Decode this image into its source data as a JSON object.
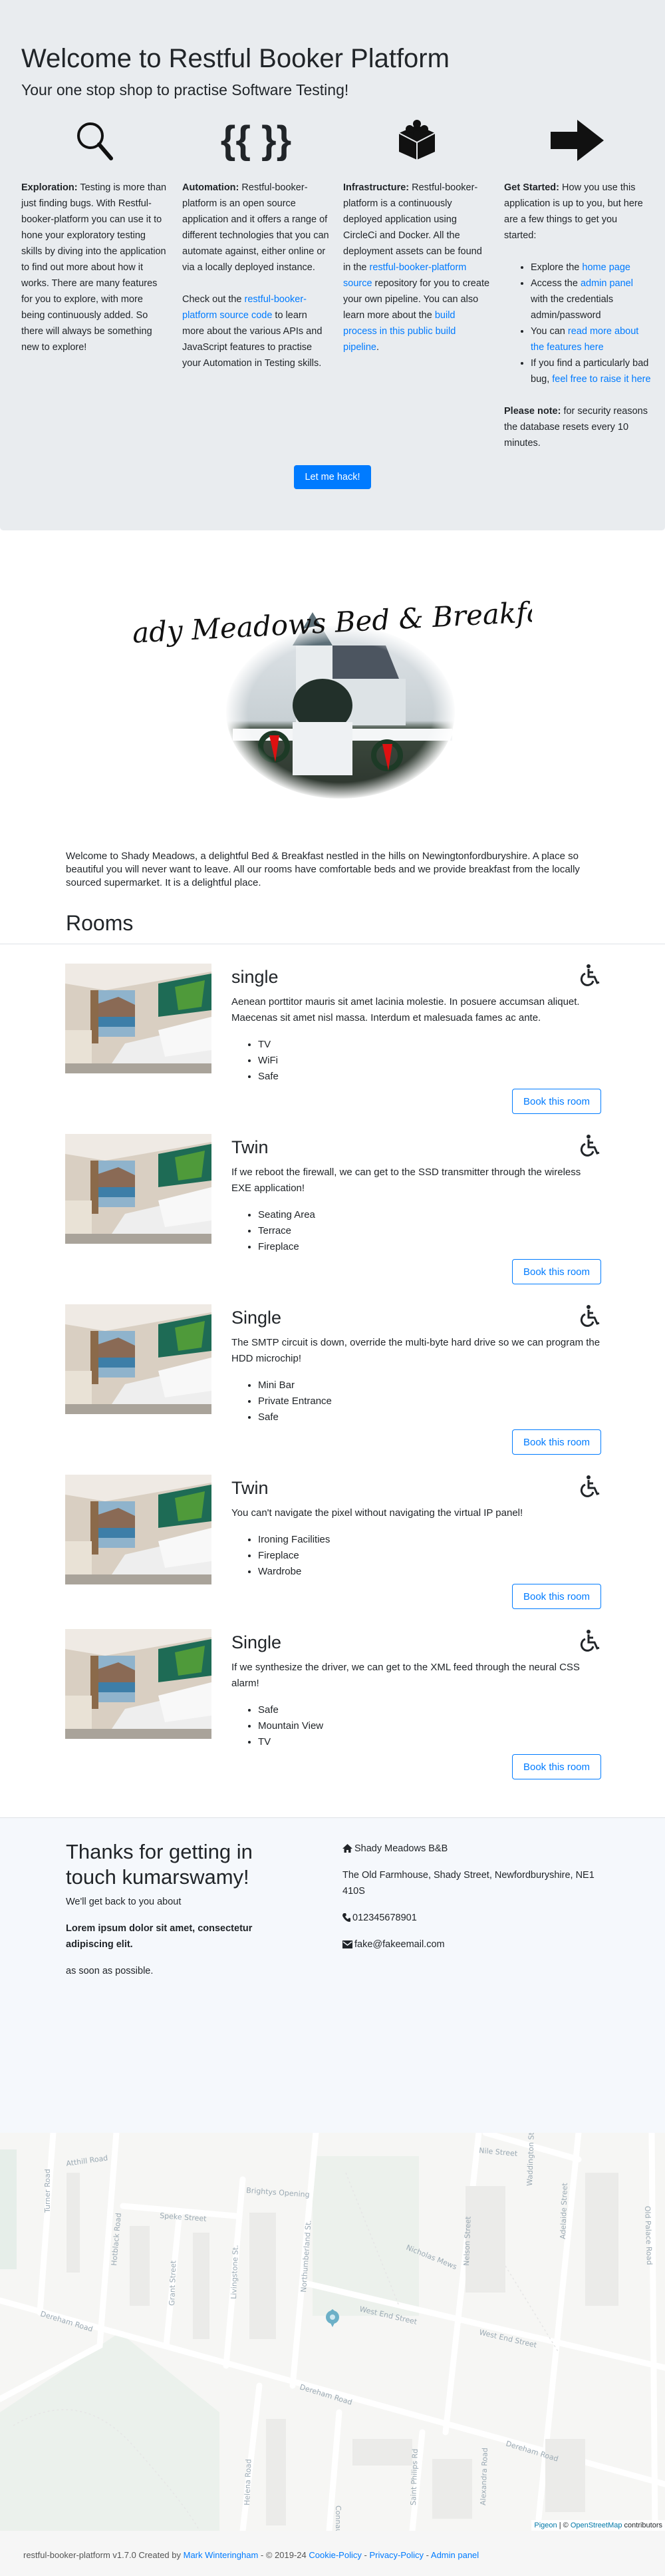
{
  "hero": {
    "title": "Welcome to Restful Booker Platform",
    "subtitle": "Your one stop shop to practise Software Testing!",
    "columns": [
      {
        "icon": "magnifier-icon",
        "label": "Exploration:",
        "text": " Testing is more than just finding bugs. With Restful-booker-platform you can use it to hone your exploratory testing skills by diving into the application to find out more about how it works. There are many features for you to explore, with more being continuously added. So there will always be something new to explore!"
      },
      {
        "icon": "curly-braces-icon",
        "icon_text": "{{ }}",
        "label": "Automation:",
        "text": " Restful-booker-platform is an open source application and it offers a range of different technologies that you can automate against, either online or via a locally deployed instance.",
        "p2_pre": "Check out the ",
        "p2_link": "restful-booker-platform source code",
        "p2_post": " to learn more about the various APIs and JavaScript features to practise your Automation in Testing skills."
      },
      {
        "icon": "lego-brick-icon",
        "label": "Infrastructure:",
        "text": " Restful-booker-platform is a continuously deployed application using CircleCi and Docker. All the deployment assets can be found in the ",
        "link1": "restful-booker-platform source",
        "mid": " repository for you to create your own pipeline. You can also learn more about the ",
        "link2": "build process in this public build pipeline",
        "end": "."
      },
      {
        "icon": "arrow-right-icon",
        "label": "Get Started:",
        "text": " How you use this application is up to you, but here are a few things to get you started:",
        "items": [
          {
            "pre": "Explore the ",
            "link": "home page",
            "post": ""
          },
          {
            "pre": "Access the ",
            "link": "admin panel",
            "post": " with the credentials admin/password"
          },
          {
            "pre": "You can ",
            "link": "read more about the features here",
            "post": ""
          },
          {
            "pre": "If you find a particularly bad bug, ",
            "link": "feel free to raise it here",
            "post": ""
          }
        ],
        "note_label": "Please note:",
        "note": " for security reasons the database resets every 10 minutes."
      }
    ],
    "button": "Let me hack!"
  },
  "logo_text": "Shady Meadows Bed & Breakfast",
  "intro": "Welcome to Shady Meadows, a delightful Bed & Breakfast nestled in the hills on Newingtonfordburyshire. A place so beautiful you will never want to leave. All our rooms have comfortable beds and we provide breakfast from the locally sourced supermarket. It is a delightful place.",
  "rooms_heading": "Rooms",
  "book_label": "Book this room",
  "rooms": [
    {
      "name": "single",
      "description": "Aenean porttitor mauris sit amet lacinia molestie. In posuere accumsan aliquet. Maecenas sit amet nisl massa. Interdum et malesuada fames ac ante.",
      "features": [
        "TV",
        "WiFi",
        "Safe"
      ]
    },
    {
      "name": "Twin",
      "description": "If we reboot the firewall, we can get to the SSD transmitter through the wireless EXE application!",
      "features": [
        "Seating Area",
        "Terrace",
        "Fireplace"
      ]
    },
    {
      "name": "Single",
      "description": "The SMTP circuit is down, override the multi-byte hard drive so we can program the HDD microchip!",
      "features": [
        "Mini Bar",
        "Private Entrance",
        "Safe"
      ]
    },
    {
      "name": "Twin",
      "description": "You can't navigate the pixel without navigating the virtual IP panel!",
      "features": [
        "Ironing Facilities",
        "Fireplace",
        "Wardrobe"
      ]
    },
    {
      "name": "Single",
      "description": "If we synthesize the driver, we can get to the XML feed through the neural CSS alarm!",
      "features": [
        "Safe",
        "Mountain View",
        "TV"
      ]
    }
  ],
  "contact": {
    "title": "Thanks for getting in touch kumarswamy!",
    "line1": "We'll get back to you about",
    "subject": "Lorem ipsum dolor sit amet, consectetur adipiscing elit.",
    "line2": "as soon as possible.",
    "name": "Shady Meadows B&B",
    "address": "The Old Farmhouse, Shady Street, Newfordburyshire, NE1 410S",
    "phone": "012345678901",
    "email": "fake@fakeemail.com"
  },
  "map": {
    "labels": [
      "Dereham Road",
      "Dereham Road",
      "Dereham Road",
      "West End Street",
      "West End Street",
      "Hotblack Road",
      "Turner Road",
      "Atthill Road",
      "Speke Street",
      "Grant Street",
      "Livingstone St.",
      "Brightys Opening",
      "Northumberland St.",
      "Nicholas Mews",
      "Nelson Street",
      "Nile Street",
      "Waddington St.",
      "Adelaide Street",
      "Old Palace Road",
      "Helena Road",
      "Connaught Road",
      "Saint Philips Rd",
      "Alexandra Road"
    ],
    "attribution_link1": "Pigeon",
    "attribution_sep": " | © ",
    "attribution_link2": "OpenStreetMap",
    "attribution_post": " contributors"
  },
  "footer": {
    "pre": "restful-booker-platform v1.7.0 Created by ",
    "author": "Mark Winteringham",
    "mid": " - © 2019-24 ",
    "cookie": "Cookie-Policy",
    "privacy": "Privacy-Policy",
    "admin": "Admin panel",
    "sep": " - "
  }
}
